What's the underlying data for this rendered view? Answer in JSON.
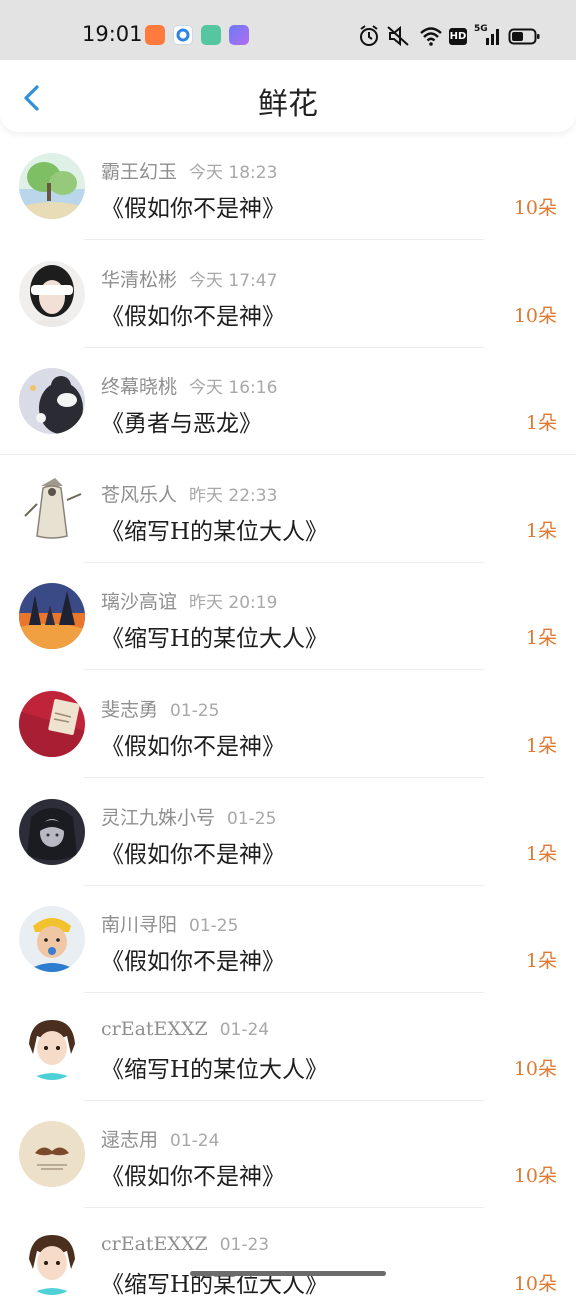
{
  "status_bar": {
    "time": "19:01",
    "icons": [
      "notification-app-icon-orange",
      "notification-app-icon-blue",
      "notification-app-icon-green",
      "notification-app-icon-purple",
      "alarm-icon",
      "mute-icon",
      "wifi-icon",
      "hd-icon",
      "5g-signal-icon",
      "battery-icon"
    ],
    "hd_label": "HD",
    "network_label": "5G"
  },
  "header": {
    "title": "鲜花",
    "back_icon": "chevron-left-icon",
    "accent_color": "#2f8fd8"
  },
  "items": [
    {
      "user": "霸王幻玉",
      "time": "今天 18:23",
      "book": "《假如你不是神》",
      "count": "10朵",
      "avatar": "landscape-painting"
    },
    {
      "user": "华清松彬",
      "time": "今天 17:47",
      "book": "《假如你不是神》",
      "count": "10朵",
      "avatar": "blindfolded-girl"
    },
    {
      "user": "终幕晓桃",
      "time": "今天 16:16",
      "book": "《勇者与恶龙》",
      "count": "1朵",
      "avatar": "cartoon-panda"
    },
    {
      "user": "苍风乐人",
      "time": "昨天 22:33",
      "book": "《缩写H的某位大人》",
      "count": "1朵",
      "avatar": "white-robed-figure"
    },
    {
      "user": "璃沙高谊",
      "time": "昨天 20:19",
      "book": "《缩写H的某位大人》",
      "count": "1朵",
      "avatar": "sunset-trees"
    },
    {
      "user": "斐志勇",
      "time": "01-25",
      "book": "《假如你不是神》",
      "count": "1朵",
      "avatar": "red-envelope"
    },
    {
      "user": "灵江九姝小号",
      "time": "01-25",
      "book": "《假如你不是神》",
      "count": "1朵",
      "avatar": "dark-anime-character"
    },
    {
      "user": "南川寻阳",
      "time": "01-25",
      "book": "《假如你不是神》",
      "count": "1朵",
      "avatar": "child-photo"
    },
    {
      "user": "crEatEXXZ",
      "time": "01-24",
      "book": "《缩写H的某位大人》",
      "count": "10朵",
      "avatar": "anime-boy"
    },
    {
      "user": "逯志用",
      "time": "01-24",
      "book": "《假如你不是神》",
      "count": "10朵",
      "avatar": "mustache-logo"
    },
    {
      "user": "crEatEXXZ",
      "time": "01-23",
      "book": "《缩写H的某位大人》",
      "count": "10朵",
      "avatar": "anime-boy"
    }
  ],
  "colors": {
    "count": "#e07a32",
    "username": "#8f8f8f",
    "title_text": "#1e1e1e"
  }
}
